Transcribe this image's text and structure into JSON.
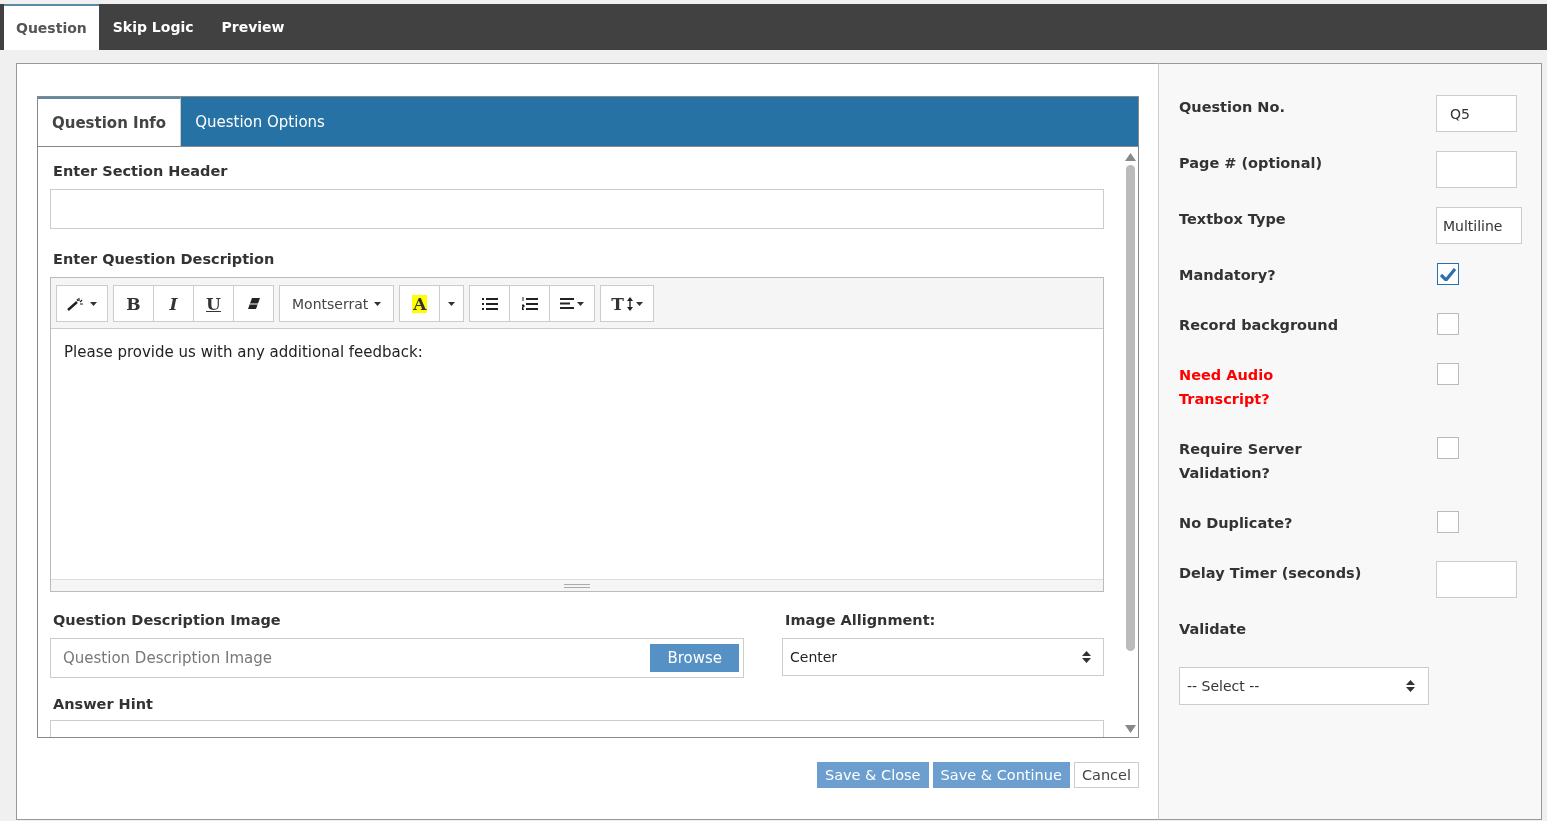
{
  "top_tabs": [
    {
      "label": "Question",
      "selected": true
    },
    {
      "label": "Skip Logic",
      "selected": false
    },
    {
      "label": "Preview",
      "selected": false
    }
  ],
  "inner_tabs": [
    {
      "label": "Question Info",
      "selected": true
    },
    {
      "label": "Question Options",
      "selected": false
    }
  ],
  "section_header": {
    "label": "Enter Section Header"
  },
  "description": {
    "label": "Enter Question Description",
    "text": "Please provide us with any additional feedback:",
    "toolbar": [
      [
        {
          "kind": "wand"
        }
      ],
      [
        {
          "kind": "bold",
          "label": "B"
        },
        {
          "kind": "italic",
          "label": "I"
        },
        {
          "kind": "underline",
          "label": "U"
        },
        {
          "kind": "eraser"
        }
      ],
      [
        {
          "kind": "font",
          "label": "Montserrat"
        }
      ],
      [
        {
          "kind": "highlight",
          "label": "A"
        },
        {
          "kind": "caret"
        }
      ],
      [
        {
          "kind": "bullets"
        },
        {
          "kind": "numbers"
        },
        {
          "kind": "align"
        }
      ],
      [
        {
          "kind": "size",
          "label": "T"
        }
      ]
    ]
  },
  "image": {
    "label": "Question Description Image",
    "placeholder": "Question Description Image",
    "button": "Browse"
  },
  "alignment": {
    "label": "Image Allignment:",
    "value": "Center"
  },
  "answer_hint": {
    "label": "Answer Hint"
  },
  "buttons": [
    {
      "label": "Save & Close",
      "kind": "primary"
    },
    {
      "label": "Save & Continue",
      "kind": "primary"
    },
    {
      "label": "Cancel",
      "kind": "plain"
    }
  ],
  "settings": [
    {
      "kind": "field",
      "label": "Question No.",
      "value": "Q5"
    },
    {
      "kind": "field",
      "label": "Page # (optional)"
    },
    {
      "kind": "field",
      "label": "Textbox Type",
      "value": "Multiline",
      "wide": true
    },
    {
      "kind": "checkbox",
      "label": "Mandatory?",
      "checked": true
    },
    {
      "kind": "checkbox",
      "label": "Record background",
      "checked": false
    },
    {
      "kind": "checkbox",
      "label": "Need Audio Transcript?",
      "checked": false,
      "warning": true
    },
    {
      "kind": "checkbox",
      "label": "Require Server Validation?",
      "checked": false
    },
    {
      "kind": "checkbox",
      "label": "No Duplicate?",
      "checked": false
    },
    {
      "kind": "field",
      "label": "Delay Timer (seconds)"
    },
    {
      "kind": "select",
      "label": "Validate",
      "value": "-- Select --"
    }
  ]
}
